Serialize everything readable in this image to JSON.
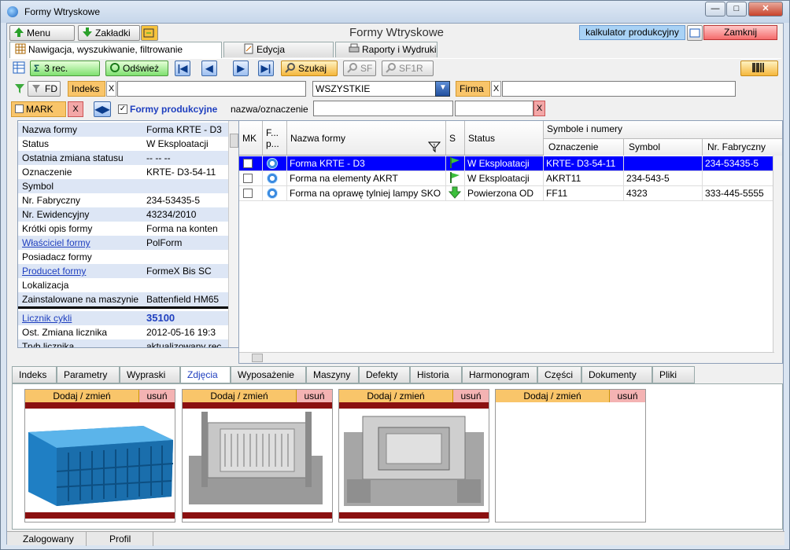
{
  "window": {
    "title": "Formy Wtryskowe"
  },
  "toolbar": {
    "menu": "Menu",
    "bookmarks": "Zakładki",
    "center_title": "Formy Wtryskowe",
    "calculator": "kalkulator produkcyjny",
    "close": "Zamknij"
  },
  "tabs": [
    {
      "label": "Nawigacja, wyszukiwanie, filtrowanie"
    },
    {
      "label": "Edycja"
    },
    {
      "label": "Raporty i Wydruki"
    }
  ],
  "nav": {
    "count": "3 rec.",
    "refresh": "Odśwież",
    "search": "Szukaj",
    "sf": "SF",
    "sf1r": "SF1R"
  },
  "filters": {
    "fd": "FD",
    "index_label": "Indeks",
    "x": "X",
    "category_value": "WSZYSTKIE",
    "firm_label": "Firma",
    "mark_label": "MARK",
    "production_forms": "Formy produkcyjne",
    "name_label": "nazwa/oznaczenie"
  },
  "details": [
    {
      "k": "Nazwa formy",
      "v": "Forma  KRTE - D3"
    },
    {
      "k": "Status",
      "v": "W Eksploatacji"
    },
    {
      "k": "Ostatnia zmiana statusu",
      "v": "-- --  --"
    },
    {
      "k": "Oznaczenie",
      "v": "KRTE- D3-54-11"
    },
    {
      "k": "Symbol",
      "v": ""
    },
    {
      "k": "Nr. Fabryczny",
      "v": "234-53435-5"
    },
    {
      "k": "Nr. Ewidencyjny",
      "v": "43234/2010"
    },
    {
      "k": "Krótki opis formy",
      "v": "Forma na konten"
    },
    {
      "k": "Właściciel formy",
      "v": "PolForm"
    },
    {
      "k": "Posiadacz formy",
      "v": ""
    },
    {
      "k": "Producet formy",
      "v": "FormeX Bis SC"
    },
    {
      "k": "Lokalizacja",
      "v": ""
    },
    {
      "k": "Zainstalowane na maszynie",
      "v": "Battenfield HM65"
    },
    {
      "k": "Licznik cykli",
      "v": "35100"
    },
    {
      "k": "Ost. Zmiana licznika",
      "v": "2012-05-16  19:3"
    },
    {
      "k": "Tryb licznika",
      "v": "aktualizowany rec"
    }
  ],
  "grid": {
    "headers": {
      "mk": "MK",
      "fp": "F... p...",
      "name": "Nazwa formy",
      "s": "S",
      "status": "Status",
      "group": "Symbole i numery",
      "oznaczenie": "Oznaczenie",
      "symbol": "Symbol",
      "nr": "Nr. Fabryczny"
    },
    "rows": [
      {
        "name": "Forma  KRTE - D3",
        "status": "W Eksploatacji",
        "oznaczenie": "KRTE- D3-54-11",
        "symbol": "",
        "nr": "234-53435-5",
        "selected": true
      },
      {
        "name": "Forma na elementy AKRT",
        "status": "W Eksploatacji",
        "oznaczenie": "AKRT11",
        "symbol": "234-543-5",
        "nr": "",
        "selected": false
      },
      {
        "name": "Forma na oprawę tylniej lampy SKO",
        "status": "Powierzona OD",
        "oznaczenie": "FF11",
        "symbol": "4323",
        "nr": "333-445-5555",
        "selected": false
      }
    ]
  },
  "bottom_tabs": [
    {
      "label": "Indeks"
    },
    {
      "label": "Parametry"
    },
    {
      "label": "Wypraski"
    },
    {
      "label": "Zdjęcia"
    },
    {
      "label": "Wyposażenie"
    },
    {
      "label": "Maszyny"
    },
    {
      "label": "Defekty"
    },
    {
      "label": "Historia"
    },
    {
      "label": "Harmonogram"
    },
    {
      "label": "Części"
    },
    {
      "label": "Dokumenty"
    },
    {
      "label": "Pliki"
    }
  ],
  "photos": {
    "add": "Dodaj / zmień",
    "del": "usuń"
  },
  "status": {
    "logged": "Zalogowany",
    "profile": "Profil"
  }
}
